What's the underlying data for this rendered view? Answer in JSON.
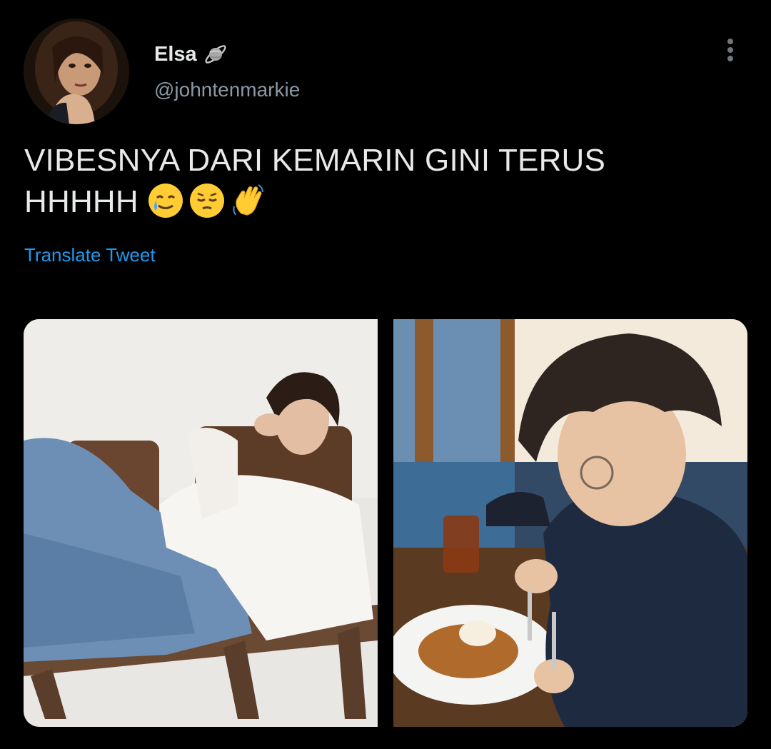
{
  "tweet": {
    "display_name": "Elsa",
    "name_emoji": "planet-icon",
    "handle": "@johntenmarkie",
    "text_line1": "VIBESNYA DARI KEMARIN GINI TERUS",
    "text_line2": "HHHHH",
    "emojis": [
      "smiling-face-with-tear-icon",
      "pensive-face-icon",
      "waving-hand-icon"
    ],
    "translate_label": "Translate Tweet"
  },
  "media": {
    "photos": [
      {
        "name": "photo-man-lounging-on-bench"
      },
      {
        "name": "photo-man-eating-french-toast"
      }
    ]
  },
  "colors": {
    "background": "#000000",
    "text": "#e7e9ea",
    "secondary_text": "#8b98a5",
    "link": "#1d9bf0"
  }
}
